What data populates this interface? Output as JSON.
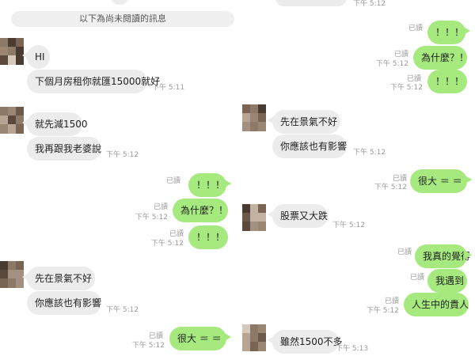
{
  "divider_unread": "以下為尚未閱讀的訊息",
  "read_label": "已讀",
  "left": {
    "m1": {
      "text": "HI"
    },
    "m2": {
      "text": "下個月房租你就匯15000就好",
      "time": "下午 5:11"
    },
    "m3": {
      "text": "就先減1500"
    },
    "m4": {
      "text": "我再跟我老婆說",
      "time": "下午 5:12"
    },
    "m5": {
      "text": "！！！"
    },
    "m6": {
      "text": "為什麼？！",
      "time": "下午 5:12"
    },
    "m7": {
      "text": "！！！",
      "time": "下午 5:12"
    },
    "m8": {
      "text": "先在景氣不好"
    },
    "m9": {
      "text": "你應該也有影響",
      "time": "下午 5:12"
    },
    "m10": {
      "text": "很大 ＝ ＝",
      "time": "下午 5:12"
    }
  },
  "right": {
    "top_time": "下午 5:12",
    "m1": {
      "text": "！！！"
    },
    "m2": {
      "text": "為什麼？！",
      "time": "下午 5:12"
    },
    "m3": {
      "text": "！！！",
      "time": "下午 5:12"
    },
    "m4": {
      "text": "先在景氣不好"
    },
    "m5": {
      "text": "你應該也有影響",
      "time": "下午 5:12"
    },
    "m6": {
      "text": "很大 ＝ ＝",
      "time": "下午 5:12"
    },
    "m7": {
      "text": "股票又大跌",
      "time": "下午 5:12"
    },
    "m8": {
      "text": "我真的覺得"
    },
    "m9": {
      "text": "我遇到"
    },
    "m10": {
      "text": "人生中的貴人",
      "time": "下午 5:12"
    },
    "m11": {
      "text": "雖然1500不多",
      "time": "下午 5:13"
    }
  }
}
